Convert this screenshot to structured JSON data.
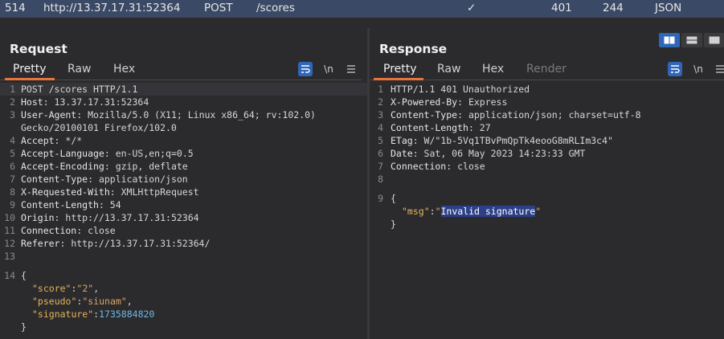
{
  "history_row": {
    "id": "514",
    "host": "http://13.37.17.31:52364",
    "method": "POST",
    "path": "/scores",
    "check": "✓",
    "status": "401",
    "length": "244",
    "mime": "JSON"
  },
  "request": {
    "title": "Request",
    "tabs": [
      "Pretty",
      "Raw",
      "Hex"
    ],
    "newline_label": "\\n",
    "lines": [
      {
        "n": "1",
        "k": "",
        "v": "POST /scores HTTP/1.1"
      },
      {
        "n": "2",
        "k": "Host",
        "v": ": 13.37.17.31:52364"
      },
      {
        "n": "3",
        "k": "User-Agent",
        "v": ": Mozilla/5.0 (X11; Linux x86_64; rv:102.0)"
      },
      {
        "n": "",
        "k": "",
        "v": "Gecko/20100101 Firefox/102.0"
      },
      {
        "n": "4",
        "k": "Accept",
        "v": ": */*"
      },
      {
        "n": "5",
        "k": "Accept-Language",
        "v": ": en-US,en;q=0.5"
      },
      {
        "n": "6",
        "k": "Accept-Encoding",
        "v": ": gzip, deflate"
      },
      {
        "n": "7",
        "k": "Content-Type",
        "v": ": application/json"
      },
      {
        "n": "8",
        "k": "X-Requested-With",
        "v": ": XMLHttpRequest"
      },
      {
        "n": "9",
        "k": "Content-Length",
        "v": ": 54"
      },
      {
        "n": "10",
        "k": "Origin",
        "v": ": http://13.37.17.31:52364"
      },
      {
        "n": "11",
        "k": "Connection",
        "v": ": close"
      },
      {
        "n": "12",
        "k": "Referer",
        "v": ": http://13.37.17.31:52364/"
      },
      {
        "n": "13",
        "k": "",
        "v": ""
      },
      {
        "n": "14",
        "k": "",
        "v": "{"
      }
    ],
    "json": [
      {
        "key": "\"score\"",
        "sep": ":",
        "val": "\"2\"",
        "type": "str",
        "end": ","
      },
      {
        "key": "\"pseudo\"",
        "sep": ":",
        "val": "\"siunam\"",
        "type": "str",
        "end": ","
      },
      {
        "key": "\"signature\"",
        "sep": ":",
        "val": "1735884820",
        "type": "num",
        "end": ""
      }
    ],
    "close_brace": "}"
  },
  "response": {
    "title": "Response",
    "tabs": [
      "Pretty",
      "Raw",
      "Hex",
      "Render"
    ],
    "newline_label": "\\n",
    "lines": [
      {
        "n": "1",
        "k": "",
        "v": "HTTP/1.1 401 Unauthorized"
      },
      {
        "n": "2",
        "k": "X-Powered-By",
        "v": ": Express"
      },
      {
        "n": "3",
        "k": "Content-Type",
        "v": ": application/json; charset=utf-8"
      },
      {
        "n": "4",
        "k": "Content-Length",
        "v": ": 27"
      },
      {
        "n": "5",
        "k": "ETag",
        "v": ": W/\"1b-5Vq1TBvPmQpTk4eooG8mRLIm3c4\""
      },
      {
        "n": "6",
        "k": "Date",
        "v": ": Sat, 06 May 2023 14:23:33 GMT"
      },
      {
        "n": "7",
        "k": "Connection",
        "v": ": close"
      },
      {
        "n": "8",
        "k": "",
        "v": ""
      },
      {
        "n": "9",
        "k": "",
        "v": "{"
      }
    ],
    "json_key": "\"msg\"",
    "json_sep": ":",
    "json_q1": "\"",
    "json_val": "Invalid signature",
    "json_q2": "\"",
    "close_brace": "}"
  },
  "icons": {
    "wrap": "wrap-lines-icon",
    "menu": "menu-icon",
    "layout": [
      "split-horizontal-icon",
      "split-vertical-icon",
      "single-pane-icon"
    ]
  }
}
